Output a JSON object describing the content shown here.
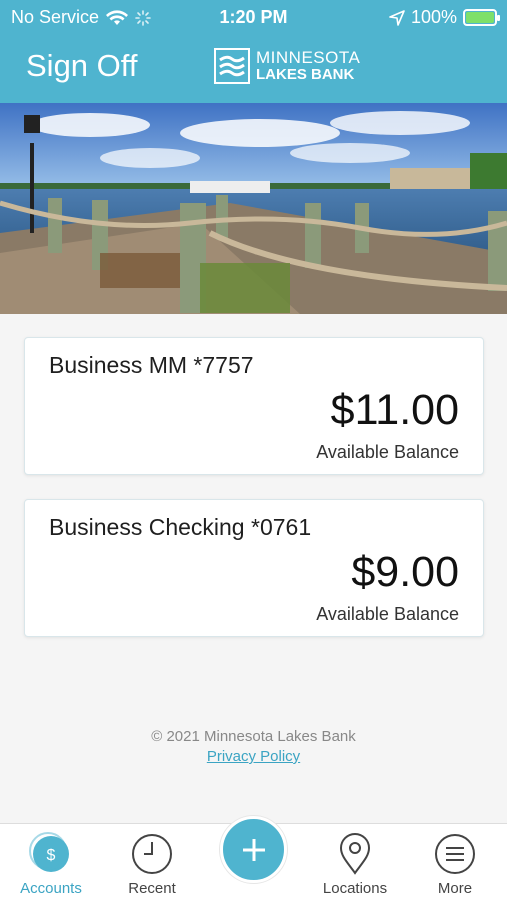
{
  "status_bar": {
    "carrier": "No Service",
    "time": "1:20 PM",
    "battery": "100%"
  },
  "header": {
    "sign_off": "Sign Off",
    "logo_line1": "MINNESOTA",
    "logo_line2": "LAKES BANK",
    "background_color": "#4fb4cf"
  },
  "accounts": [
    {
      "name": "Business MM *7757",
      "amount": "$11.00",
      "balance_label": "Available Balance"
    },
    {
      "name": "Business Checking *0761",
      "amount": "$9.00",
      "balance_label": "Available Balance"
    }
  ],
  "footer": {
    "copyright": "© 2021 Minnesota Lakes Bank",
    "privacy": "Privacy Policy"
  },
  "tabs": [
    {
      "label": "Accounts",
      "icon": "dollar-icon",
      "active": true
    },
    {
      "label": "Recent",
      "icon": "clock-icon"
    },
    {
      "label": "Add",
      "icon": "plus-icon"
    },
    {
      "label": "Locations",
      "icon": "map-pin-icon"
    },
    {
      "label": "More",
      "icon": "menu-icon"
    }
  ],
  "accent_color": "#3ba4c3"
}
